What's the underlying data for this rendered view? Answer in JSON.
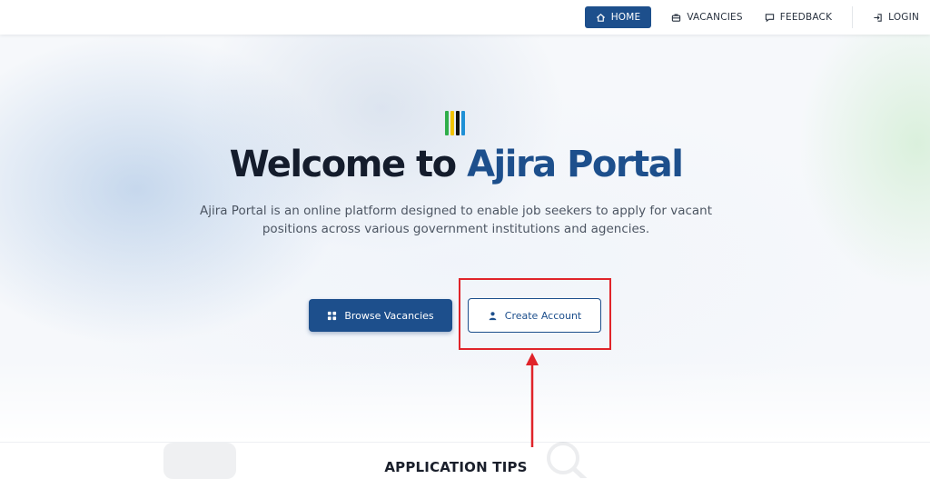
{
  "nav": {
    "items": [
      {
        "label": "HOME",
        "icon": "home-icon",
        "active": true
      },
      {
        "label": "VACANCIES",
        "icon": "briefcase-icon",
        "active": false
      },
      {
        "label": "FEEDBACK",
        "icon": "chat-icon",
        "active": false
      },
      {
        "label": "LOGIN",
        "icon": "login-icon",
        "active": false
      }
    ]
  },
  "hero": {
    "logo_colors": [
      "#2fae4a",
      "#f2c300",
      "#111111",
      "#1e90d6"
    ],
    "title_prefix": "Welcome to ",
    "title_brand": "Ajira Portal",
    "subtitle": "Ajira Portal is an online platform designed to enable job seekers to apply for vacant positions across various government institutions and agencies.",
    "browse_button": "Browse Vacancies",
    "create_button": "Create Account"
  },
  "section": {
    "tips_heading": "APPLICATION TIPS"
  },
  "colors": {
    "primary": "#1d4f8c",
    "annotation": "#e0242a"
  }
}
